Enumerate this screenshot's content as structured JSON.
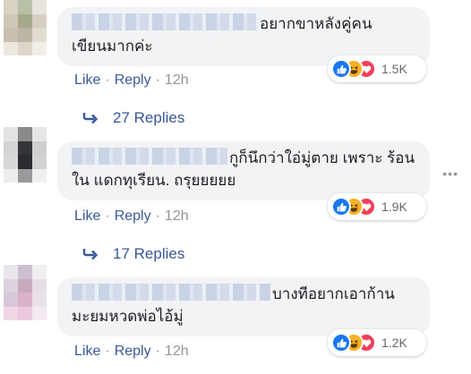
{
  "comments": [
    {
      "text": "อยากขาหลังคู่คน\nเขียนมากค่ะ",
      "reaction_count": "1.5K",
      "like": "Like",
      "reply": "Reply",
      "time": "12h",
      "replies_label": "27 Replies"
    },
    {
      "text": "กูก็นึกว่าใอ่มู่ตาย เพราะ ร้อน\nใน แดกทุเรียน. ถรุยยยยย",
      "reaction_count": "1.9K",
      "like": "Like",
      "reply": "Reply",
      "time": "12h",
      "replies_label": "17 Replies"
    },
    {
      "text": "บางทีอยากเอาก้าน\nมะยมหวดพ่อไอ้มู่",
      "reaction_count": "1.2K",
      "like": "Like",
      "reply": "Reply",
      "time": "12h"
    }
  ],
  "colors": {
    "link": "#385898",
    "bubble": "#f2f3f5",
    "like": "#1877f2",
    "haha": "#f7b125",
    "love": "#f33e58"
  },
  "icons": [
    "like-reaction-icon",
    "haha-reaction-icon",
    "love-reaction-icon",
    "reply-arrow-icon",
    "more-options-icon"
  ]
}
